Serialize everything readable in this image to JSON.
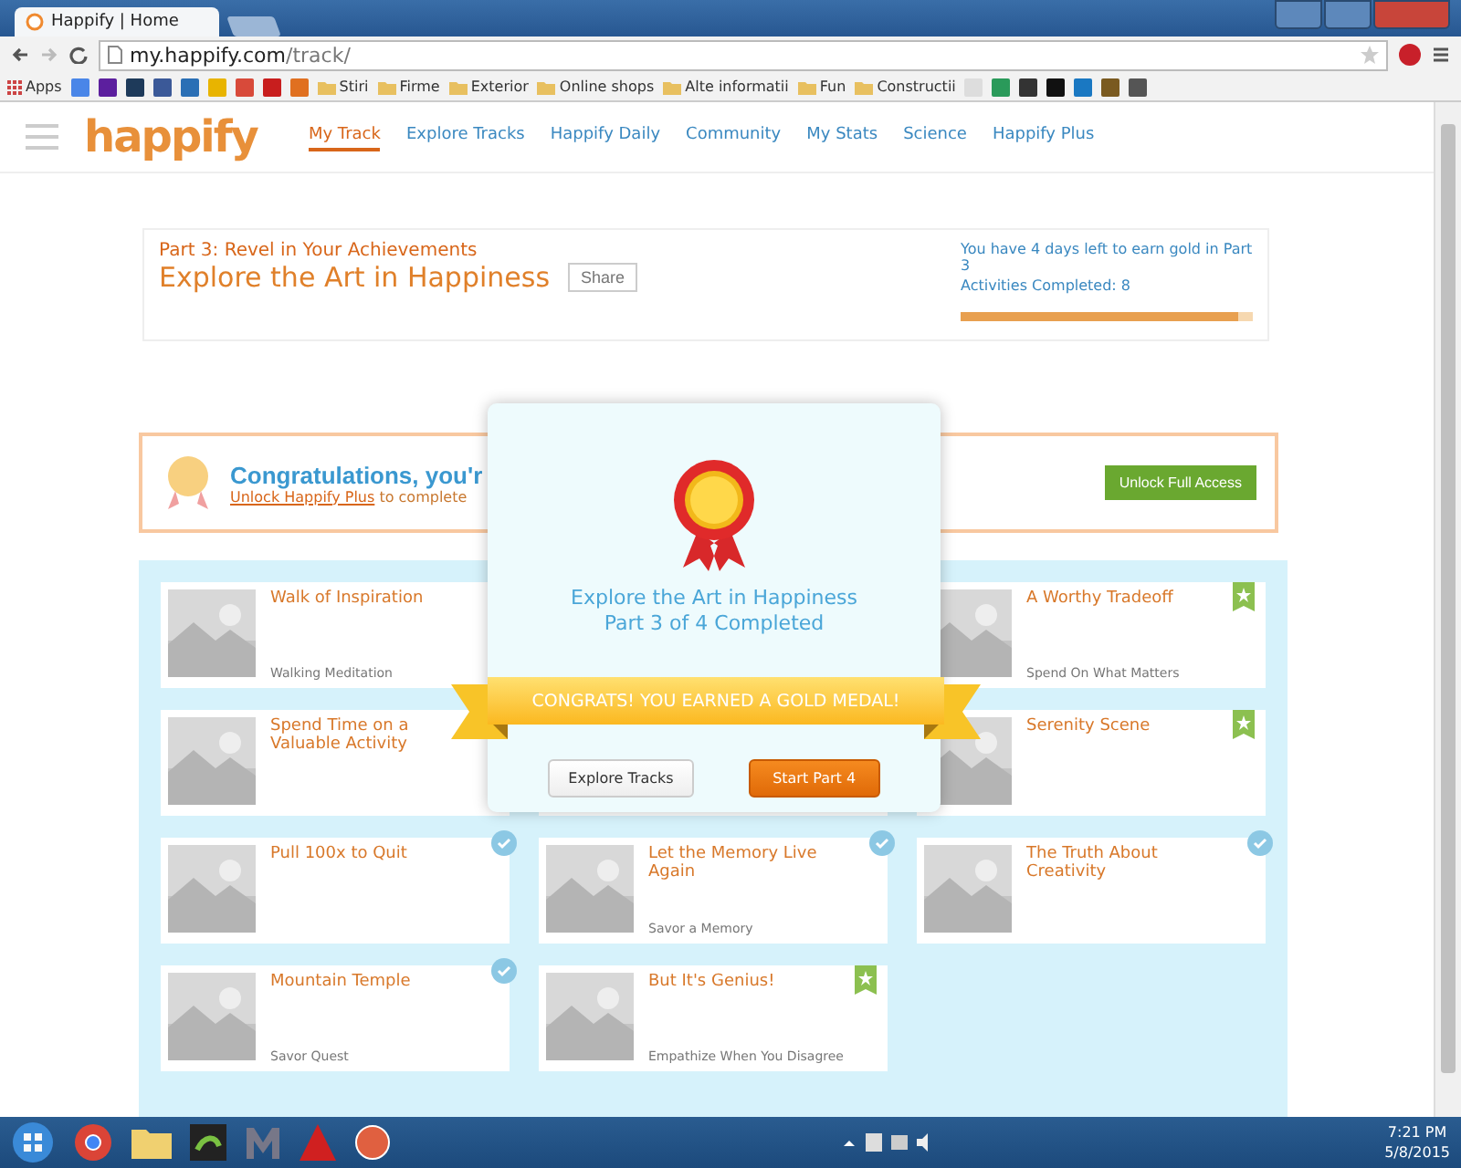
{
  "browser": {
    "tab_title": "Happify | Home",
    "url_host": "my.happify.com",
    "url_path": "/track/",
    "bookmarks": [
      {
        "label": "Apps",
        "kind": "apps"
      },
      {
        "kind": "site",
        "color": "#4a86e8"
      },
      {
        "kind": "site",
        "color": "#5c1f9e"
      },
      {
        "kind": "site",
        "color": "#1e3a5a"
      },
      {
        "kind": "site",
        "color": "#3b5998"
      },
      {
        "kind": "site",
        "color": "#2a6fb5"
      },
      {
        "kind": "site",
        "color": "#e8b400"
      },
      {
        "kind": "site",
        "color": "#d84a3a"
      },
      {
        "kind": "site",
        "color": "#c81e1e"
      },
      {
        "kind": "site",
        "color": "#e07020"
      },
      {
        "label": "Stiri",
        "kind": "folder"
      },
      {
        "label": "Firme",
        "kind": "folder"
      },
      {
        "label": "Exterior",
        "kind": "folder"
      },
      {
        "label": "Online shops",
        "kind": "folder"
      },
      {
        "label": "Alte informatii",
        "kind": "folder"
      },
      {
        "label": "Fun",
        "kind": "folder"
      },
      {
        "label": "Constructii",
        "kind": "folder"
      },
      {
        "kind": "site",
        "color": "#dddddd"
      },
      {
        "kind": "site",
        "color": "#2a9a5a"
      },
      {
        "kind": "site",
        "color": "#333333"
      },
      {
        "kind": "site",
        "color": "#111111"
      },
      {
        "kind": "site",
        "color": "#1a78c2"
      },
      {
        "kind": "site",
        "color": "#7a5a20"
      },
      {
        "kind": "site",
        "color": "#555555"
      }
    ]
  },
  "nav": {
    "logo": "happify",
    "items": [
      {
        "label": "My Track",
        "selected": true
      },
      {
        "label": "Explore Tracks",
        "selected": false
      },
      {
        "label": "Happify Daily",
        "selected": false
      },
      {
        "label": "Community",
        "selected": false
      },
      {
        "label": "My Stats",
        "selected": false
      },
      {
        "label": "Science",
        "selected": false
      },
      {
        "label": "Happify Plus",
        "selected": false
      }
    ]
  },
  "header": {
    "subtitle": "Part 3: Revel in Your Achievements",
    "title": "Explore the Art in Happiness",
    "share": "Share",
    "note": "You have 4 days left to earn gold in Part 3",
    "completed": "Activities Completed: 8",
    "level": 0.95
  },
  "banner": {
    "title": "Congratulations, you'r",
    "link": "Unlock Happify Plus",
    "text": "to complete",
    "button": "Unlock Full Access"
  },
  "card_rows": [
    {
      "cells": [
        {
          "kind": "activity",
          "title": "Walk of Inspiration",
          "subtitle": "Walking Meditation",
          "completed": false,
          "starred": false
        },
        {
          "kind": "covered"
        },
        {
          "kind": "activity",
          "title": "A Worthy Tradeoff",
          "subtitle": "Spend On What Matters",
          "completed": false,
          "starred": true
        }
      ]
    },
    {
      "cells": [
        {
          "kind": "activity",
          "title": "Spend Time on a Valuable Activity",
          "completed": false,
          "starred": false
        },
        {
          "kind": "covered"
        },
        {
          "kind": "activity",
          "title": "Serenity Scene",
          "completed": false,
          "starred": true
        }
      ]
    },
    {
      "cells": [
        {
          "kind": "activity",
          "title": "Pull 100x to Quit",
          "completed": true,
          "starred": false
        },
        {
          "kind": "activity",
          "title": "Let the Memory Live Again",
          "subtitle": "Savor a Memory",
          "completed": true,
          "starred": false
        },
        {
          "kind": "activity",
          "title": "The Truth About Creativity",
          "completed": true,
          "starred": false
        }
      ]
    },
    {
      "cells": [
        {
          "kind": "activity",
          "title": "Mountain Temple",
          "subtitle": "Savor Quest",
          "completed": true,
          "starred": false
        },
        {
          "kind": "activity",
          "title": "But It's Genius!",
          "subtitle": "Empathize When You Disagree",
          "completed": false,
          "starred": true
        }
      ]
    }
  ],
  "modal": {
    "title": "Explore the Art in Happiness",
    "status": "Part 3 of 4 Completed",
    "ribbon": "CONGRATS! YOU EARNED A GOLD MEDAL!",
    "buttons": [
      {
        "label": "Explore Tracks",
        "kind": "secondary"
      },
      {
        "label": "Start Part 4",
        "kind": "primary"
      }
    ]
  },
  "taskbar": {
    "time": "7:21 PM",
    "date": "5/8/2015"
  }
}
